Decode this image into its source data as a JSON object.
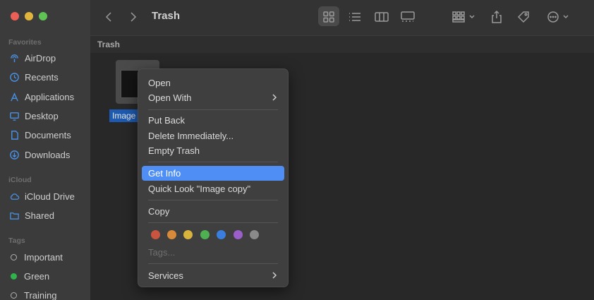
{
  "window": {
    "title": "Trash",
    "path": "Trash"
  },
  "sidebar": {
    "favorites_title": "Favorites",
    "favorites": [
      {
        "label": "AirDrop",
        "icon": "airdrop-icon"
      },
      {
        "label": "Recents",
        "icon": "clock-icon"
      },
      {
        "label": "Applications",
        "icon": "applications-icon"
      },
      {
        "label": "Desktop",
        "icon": "desktop-icon"
      },
      {
        "label": "Documents",
        "icon": "document-icon"
      },
      {
        "label": "Downloads",
        "icon": "download-icon"
      }
    ],
    "icloud_title": "iCloud",
    "icloud": [
      {
        "label": "iCloud Drive",
        "icon": "cloud-icon"
      },
      {
        "label": "Shared",
        "icon": "shared-folder-icon"
      }
    ],
    "tags_title": "Tags",
    "tags": [
      {
        "label": "Important",
        "color": "#b0b0b0",
        "outline": true
      },
      {
        "label": "Green",
        "color": "#2fb34a",
        "outline": false
      },
      {
        "label": "Training",
        "color": "#b0b0b0",
        "outline": true
      }
    ]
  },
  "file": {
    "label": "Image"
  },
  "context_menu": {
    "items": [
      {
        "label": "Open"
      },
      {
        "label": "Open With",
        "submenu": true
      },
      {
        "label": "Put Back"
      },
      {
        "label": "Delete Immediately..."
      },
      {
        "label": "Empty Trash"
      },
      {
        "label": "Get Info",
        "highlighted": true
      },
      {
        "label": "Quick Look \"Image copy\""
      },
      {
        "label": "Copy"
      },
      {
        "label": "Tags...",
        "disabled": true
      },
      {
        "label": "Services",
        "submenu": true
      }
    ],
    "tag_colors": [
      "#c9543f",
      "#d78a3a",
      "#d8b43c",
      "#4fb051",
      "#3a7fe0",
      "#9a5fc8",
      "#8a8a8a"
    ]
  }
}
